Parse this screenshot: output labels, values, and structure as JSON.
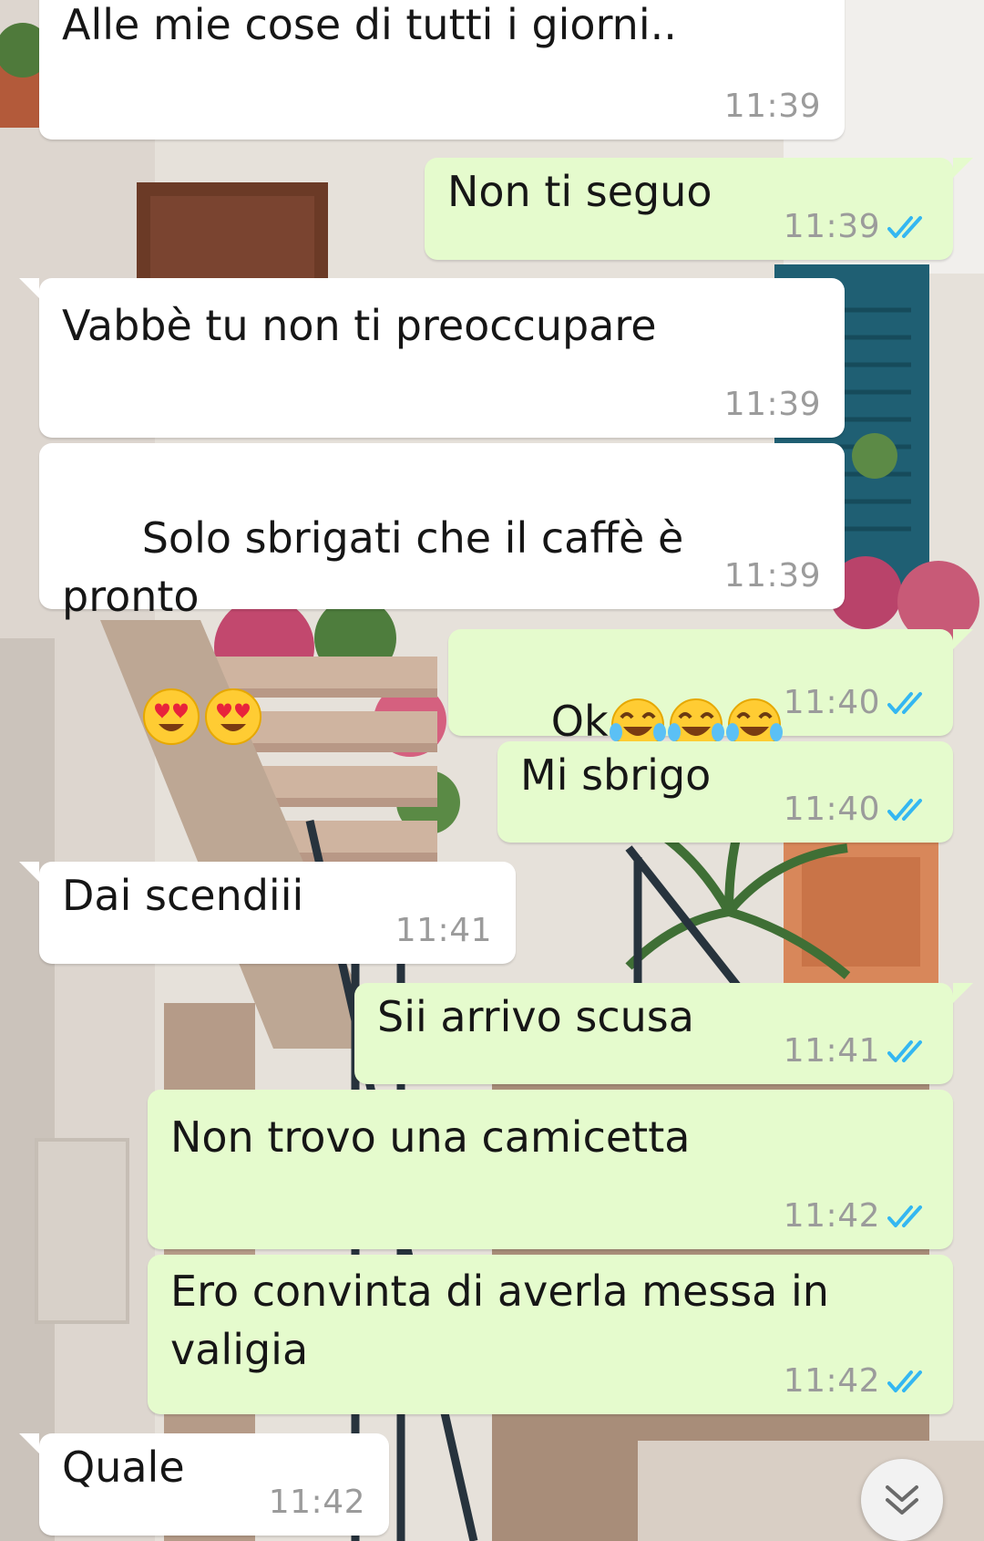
{
  "theme": {
    "incoming_bubble": "#ffffff",
    "outgoing_bubble": "#e5fbcd",
    "read_ticks_color": "#34b7f1",
    "time_color": "#9b9b9b"
  },
  "messages": [
    {
      "direction": "incoming",
      "text": "Alle mie cose di tutti i giorni..",
      "time": "11:39"
    },
    {
      "direction": "outgoing",
      "text": "Non ti seguo",
      "time": "11:39",
      "status": "read-double-check-icon"
    },
    {
      "direction": "incoming",
      "text": "Vabbè tu non ti preoccupare",
      "time": "11:39"
    },
    {
      "direction": "incoming",
      "text": "Solo sbrigati che il caffè è pronto",
      "emojis": [
        "heart-eyes-emoji",
        "heart-eyes-emoji"
      ],
      "time": "11:39"
    },
    {
      "direction": "outgoing",
      "text": "Ok",
      "emojis": [
        "tears-of-joy-emoji",
        "tears-of-joy-emoji",
        "tears-of-joy-emoji"
      ],
      "time": "11:40",
      "status": "read-double-check-icon"
    },
    {
      "direction": "outgoing",
      "text": "Mi sbrigo",
      "time": "11:40",
      "status": "read-double-check-icon"
    },
    {
      "direction": "incoming",
      "text": "Dai scendiii",
      "time": "11:41"
    },
    {
      "direction": "outgoing",
      "text": "Sii arrivo scusa",
      "time": "11:41",
      "status": "read-double-check-icon"
    },
    {
      "direction": "outgoing",
      "text": "Non trovo una camicetta",
      "time": "11:42",
      "status": "read-double-check-icon"
    },
    {
      "direction": "outgoing",
      "text": "Ero convinta di averla messa in\nvaligia",
      "time": "11:42",
      "status": "read-double-check-icon"
    },
    {
      "direction": "incoming",
      "text": "Quale",
      "time": "11:42"
    }
  ],
  "scroll_button": {
    "icon": "chevron-double-down-icon"
  }
}
